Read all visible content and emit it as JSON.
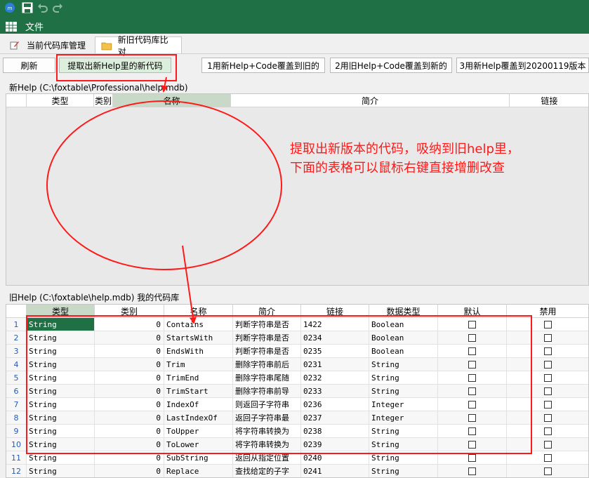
{
  "menu": {
    "file_label": "文件"
  },
  "tabs": [
    {
      "label": "当前代码库管理"
    },
    {
      "label": "新旧代码库比对"
    }
  ],
  "toolbar": {
    "refresh_label": "刷新",
    "extract_label": "提取出新Help里的新代码",
    "btn1_label": "1用新Help+Code覆盖到旧的",
    "btn2_label": "2用旧Help+Code覆盖到新的",
    "btn3_label": "3用新Help覆盖到20200119版本"
  },
  "new_help": {
    "caption": "新Help   (C:\\foxtable\\Professional\\help.mdb)",
    "columns": [
      "类型",
      "类别",
      "名称",
      "简介",
      "链接"
    ]
  },
  "old_help": {
    "caption": "旧Help   (C:\\foxtable\\help.mdb)  我的代码库",
    "columns": [
      "类型",
      "类别",
      "名称",
      "简介",
      "链接",
      "数据类型",
      "默认",
      "禁用"
    ],
    "rows": [
      {
        "n": "1",
        "type": "String",
        "cat": "0",
        "name": "Contains",
        "desc": "判断字符串是否",
        "link": "1422",
        "dtype": "Boolean"
      },
      {
        "n": "2",
        "type": "String",
        "cat": "0",
        "name": "StartsWith",
        "desc": "判断字符串是否",
        "link": "0234",
        "dtype": "Boolean"
      },
      {
        "n": "3",
        "type": "String",
        "cat": "0",
        "name": "EndsWith",
        "desc": "判断字符串是否",
        "link": "0235",
        "dtype": "Boolean"
      },
      {
        "n": "4",
        "type": "String",
        "cat": "0",
        "name": "Trim",
        "desc": "删除字符串前后",
        "link": "0231",
        "dtype": "String"
      },
      {
        "n": "5",
        "type": "String",
        "cat": "0",
        "name": "TrimEnd",
        "desc": "删除字符串尾随",
        "link": "0232",
        "dtype": "String"
      },
      {
        "n": "6",
        "type": "String",
        "cat": "0",
        "name": "TrimStart",
        "desc": "删除字符串前导",
        "link": "0233",
        "dtype": "String"
      },
      {
        "n": "7",
        "type": "String",
        "cat": "0",
        "name": "IndexOf",
        "desc": "则返回子字符串",
        "link": "0236",
        "dtype": "Integer"
      },
      {
        "n": "8",
        "type": "String",
        "cat": "0",
        "name": "LastIndexOf",
        "desc": "返回子字符串最",
        "link": "0237",
        "dtype": "Integer"
      },
      {
        "n": "9",
        "type": "String",
        "cat": "0",
        "name": "ToUpper",
        "desc": "将字符串转换为",
        "link": "0238",
        "dtype": "String"
      },
      {
        "n": "10",
        "type": "String",
        "cat": "0",
        "name": "ToLower",
        "desc": "将字符串转换为",
        "link": "0239",
        "dtype": "String"
      },
      {
        "n": "11",
        "type": "String",
        "cat": "0",
        "name": "SubString",
        "desc": "返回从指定位置",
        "link": "0240",
        "dtype": "String"
      },
      {
        "n": "12",
        "type": "String",
        "cat": "0",
        "name": "Replace",
        "desc": "查找给定的子字",
        "link": "0241",
        "dtype": "String"
      }
    ]
  },
  "annotation": {
    "line1": "提取出新版本的代码，吸纳到旧help里，",
    "line2": "下面的表格可以鼠标右键直接增删改查",
    "color": "#ff1a1a"
  },
  "colors": {
    "brand": "#1f7145",
    "selected_cell": "#1f7145"
  },
  "icons": {
    "app": "app-logo-icon",
    "save": "save-icon",
    "undo": "undo-icon",
    "redo": "redo-icon",
    "table": "table-icon"
  }
}
